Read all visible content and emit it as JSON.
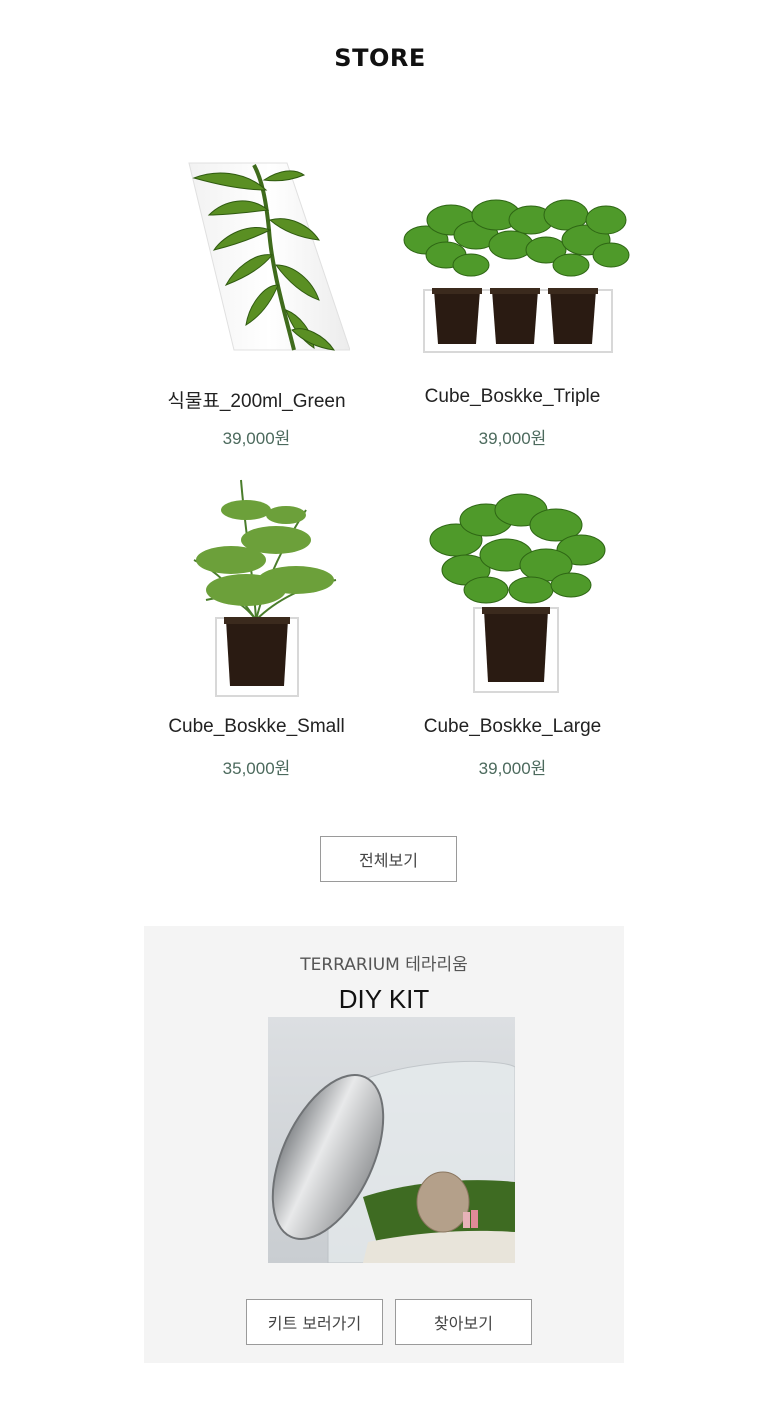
{
  "page": {
    "title": "STORE"
  },
  "products": [
    {
      "name": "식물표_200ml_Green",
      "price": "39,000원",
      "image": "leaf-bottle-image"
    },
    {
      "name": "Cube_Boskke_Triple",
      "price": "39,000원",
      "image": "basil-triple-pot-image"
    },
    {
      "name": "Cube_Boskke_Small",
      "price": "35,000원",
      "image": "asparagus-fern-pot-image"
    },
    {
      "name": "Cube_Boskke_Large",
      "price": "39,000원",
      "image": "basil-large-pot-image"
    }
  ],
  "view_all_label": "전체보기",
  "kit": {
    "subtitle": "TERRARIUM 테라리움",
    "title": "DIY KIT",
    "image": "terrarium-jar-image",
    "buttons": [
      "키트 보러가기",
      "찾아보기"
    ]
  },
  "colors": {
    "price": "#4c6a5d",
    "kit_background": "#f4f4f4",
    "button_border": "#9a9a9a"
  }
}
